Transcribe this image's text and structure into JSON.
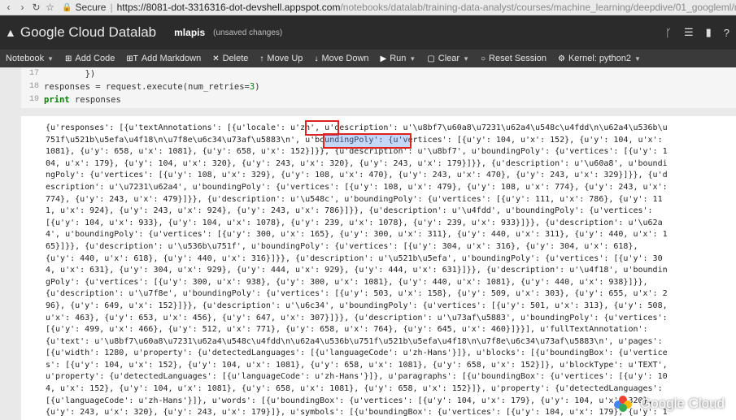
{
  "browser": {
    "secure_label": "Secure",
    "url_host": "https://8081-dot-3316316-dot-devshell.appspot.com",
    "url_path": "/notebooks/datalab/training-data-analyst/courses/machine_learning/deepdive/01_googleml/mlapis.ipy..."
  },
  "header": {
    "logo": "Google Cloud Datalab",
    "notebook_name": "mlapis",
    "status": "(unsaved changes)"
  },
  "toolbar": {
    "notebook": "Notebook",
    "add_code": "Add Code",
    "add_markdown": "Add Markdown",
    "delete": "Delete",
    "move_up": "Move Up",
    "move_down": "Move Down",
    "run": "Run",
    "clear": "Clear",
    "reset_session": "Reset Session",
    "kernel": "Kernel: python2"
  },
  "cell": {
    "line_numbers": "17\n18\n19",
    "line17": "        })",
    "line18_a": "responses = request.execute(num_retries=",
    "line18_num": "3",
    "line18_b": ")",
    "line19_kw": "print",
    "line19_rest": " responses"
  },
  "output": {
    "text": "{u'responses': [{u'textAnnotations': [{u'locale': u'zh', u'description': u'\\u8bf7\\u60a8\\u7231\\u62a4\\u548c\\u4fdd\\n\\u62a4\\u536b\\u\n751f\\u521b\\u5efa\\u4f18\\n\\u7f8e\\u6c34\\u73af\\u5883\\n', u'boundingPoly': {u'vertices': [{u'y': 104, u'x': 152}, {u'y': 104, u'x':\n1081}, {u'y': 658, u'x': 1081}, {u'y': 658, u'x': 152}]}}, {u'description': u'\\u8bf7', u'boundingPoly': {u'vertices': [{u'y': 1\n04, u'x': 179}, {u'y': 104, u'x': 320}, {u'y': 243, u'x': 320}, {u'y': 243, u'x': 179}]}}, {u'description': u'\\u60a8', u'boundi\nngPoly': {u'vertices': [{u'y': 108, u'x': 329}, {u'y': 108, u'x': 470}, {u'y': 243, u'x': 470}, {u'y': 243, u'x': 329}]}}, {u'd\nescription': u'\\u7231\\u62a4', u'boundingPoly': {u'vertices': [{u'y': 108, u'x': 479}, {u'y': 108, u'x': 774}, {u'y': 243, u'x':\n774}, {u'y': 243, u'x': 479}]}}, {u'description': u'\\u548c', u'boundingPoly': {u'vertices': [{u'y': 111, u'x': 786}, {u'y': 11\n1, u'x': 924}, {u'y': 243, u'x': 924}, {u'y': 243, u'x': 786}]}}, {u'description': u'\\u4fdd', u'boundingPoly': {u'vertices':\n[{u'y': 104, u'x': 933}, {u'y': 104, u'x': 1078}, {u'y': 239, u'x': 1078}, {u'y': 239, u'x': 933}]}}, {u'description': u'\\u62a\n4', u'boundingPoly': {u'vertices': [{u'y': 300, u'x': 165}, {u'y': 300, u'x': 311}, {u'y': 440, u'x': 311}, {u'y': 440, u'x': 1\n65}]}}, {u'description': u'\\u536b\\u751f', u'boundingPoly': {u'vertices': [{u'y': 304, u'x': 316}, {u'y': 304, u'x': 618},\n{u'y': 440, u'x': 618}, {u'y': 440, u'x': 316}]}}, {u'description': u'\\u521b\\u5efa', u'boundingPoly': {u'vertices': [{u'y': 30\n4, u'x': 631}, {u'y': 304, u'x': 929}, {u'y': 444, u'x': 929}, {u'y': 444, u'x': 631}]}}, {u'description': u'\\u4f18', u'boundin\ngPoly': {u'vertices': [{u'y': 300, u'x': 938}, {u'y': 300, u'x': 1081}, {u'y': 440, u'x': 1081}, {u'y': 440, u'x': 938}]}},\n{u'description': u'\\u7f8e', u'boundingPoly': {u'vertices': [{u'y': 503, u'x': 158}, {u'y': 509, u'x': 303}, {u'y': 655, u'x': 2\n96}, {u'y': 649, u'x': 152}]}}, {u'description': u'\\u6c34', u'boundingPoly': {u'vertices': [{u'y': 501, u'x': 313}, {u'y': 508,\nu'x': 463}, {u'y': 653, u'x': 456}, {u'y': 647, u'x': 307}]}}, {u'description': u'\\u73af\\u5883', u'boundingPoly': {u'vertices':\n[{u'y': 499, u'x': 466}, {u'y': 512, u'x': 771}, {u'y': 658, u'x': 764}, {u'y': 645, u'x': 460}]}}], u'fullTextAnnotation':\n{u'text': u'\\u8bf7\\u60a8\\u7231\\u62a4\\u548c\\u4fdd\\n\\u62a4\\u536b\\u751f\\u521b\\u5efa\\u4f18\\n\\u7f8e\\u6c34\\u73af\\u5883\\n', u'pages':\n[{u'width': 1280, u'property': {u'detectedLanguages': [{u'languageCode': u'zh-Hans'}]}, u'blocks': [{u'boundingBox': {u'vertice\ns': [{u'y': 104, u'x': 152}, {u'y': 104, u'x': 1081}, {u'y': 658, u'x': 1081}, {u'y': 658, u'x': 152}]}, u'blockType': u'TEXT',\nu'property': {u'detectedLanguages': [{u'languageCode': u'zh-Hans'}]}, u'paragraphs': [{u'boundingBox': {u'vertices': [{u'y': 10\n4, u'x': 152}, {u'y': 104, u'x': 1081}, {u'y': 658, u'x': 1081}, {u'y': 658, u'x': 152}]}, u'property': {u'detectedLanguages':\n[{u'languageCode': u'zh-Hans'}]}, u'words': [{u'boundingBox': {u'vertices': [{u'y': 104, u'x': 179}, {u'y': 104, u'x': 320},\n{u'y': 243, u'x': 320}, {u'y': 243, u'x': 179}]}, u'symbols': [{u'boundingBox': {u'vertices': [{u'y': 104, u'x': 179}, {u'y': 1"
  },
  "watermark": "Google Cloud",
  "colors": {
    "header_bg": "#2b2b2b",
    "toolbar_bg": "#3a3a3a",
    "highlight_border": "#dd2222",
    "selection_fill": "#5a8ce6"
  }
}
